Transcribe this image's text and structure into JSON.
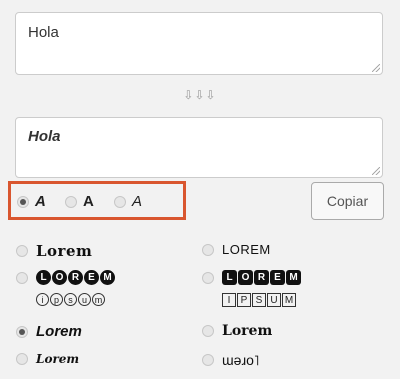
{
  "input": {
    "value": "Hola"
  },
  "arrows": "⇩⇩⇩",
  "output": {
    "value": "Hola"
  },
  "style_options": [
    {
      "label": "A",
      "style": "bold-italic",
      "checked": true
    },
    {
      "label": "A",
      "style": "bold",
      "checked": false
    },
    {
      "label": "A",
      "style": "italic",
      "checked": false
    }
  ],
  "copy_button": {
    "label": "Copiar"
  },
  "font_options": {
    "blackletter": "Lorem",
    "caps_plain": "LOREM",
    "circled_bold": [
      "L",
      "O",
      "R",
      "E",
      "M"
    ],
    "circled_light": [
      "i",
      "p",
      "s",
      "u",
      "m"
    ],
    "squared_bold": [
      "L",
      "O",
      "R",
      "E",
      "M"
    ],
    "squared_light": [
      "I",
      "P",
      "S",
      "U",
      "M"
    ],
    "bold_italic": "Lorem",
    "fraktur_bold": "Lorem",
    "script": "Lorem",
    "flipped": "ɯǝɹo˥"
  },
  "colors": {
    "highlight_border": "#d9562f",
    "background": "#f2f2f2"
  }
}
